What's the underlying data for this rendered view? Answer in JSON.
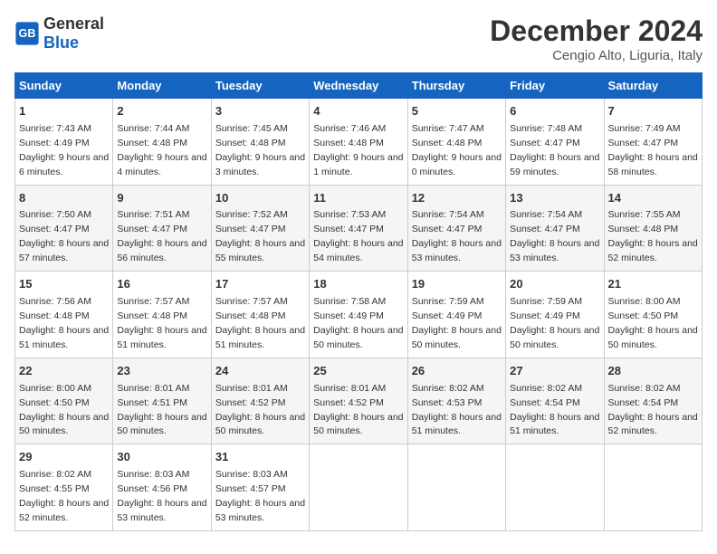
{
  "logo": {
    "general": "General",
    "blue": "Blue"
  },
  "title": "December 2024",
  "subtitle": "Cengio Alto, Liguria, Italy",
  "days_header": [
    "Sunday",
    "Monday",
    "Tuesday",
    "Wednesday",
    "Thursday",
    "Friday",
    "Saturday"
  ],
  "weeks": [
    [
      {
        "day": "1",
        "rise": "Sunrise: 7:43 AM",
        "set": "Sunset: 4:49 PM",
        "daylight": "Daylight: 9 hours and 6 minutes."
      },
      {
        "day": "2",
        "rise": "Sunrise: 7:44 AM",
        "set": "Sunset: 4:48 PM",
        "daylight": "Daylight: 9 hours and 4 minutes."
      },
      {
        "day": "3",
        "rise": "Sunrise: 7:45 AM",
        "set": "Sunset: 4:48 PM",
        "daylight": "Daylight: 9 hours and 3 minutes."
      },
      {
        "day": "4",
        "rise": "Sunrise: 7:46 AM",
        "set": "Sunset: 4:48 PM",
        "daylight": "Daylight: 9 hours and 1 minute."
      },
      {
        "day": "5",
        "rise": "Sunrise: 7:47 AM",
        "set": "Sunset: 4:48 PM",
        "daylight": "Daylight: 9 hours and 0 minutes."
      },
      {
        "day": "6",
        "rise": "Sunrise: 7:48 AM",
        "set": "Sunset: 4:47 PM",
        "daylight": "Daylight: 8 hours and 59 minutes."
      },
      {
        "day": "7",
        "rise": "Sunrise: 7:49 AM",
        "set": "Sunset: 4:47 PM",
        "daylight": "Daylight: 8 hours and 58 minutes."
      }
    ],
    [
      {
        "day": "8",
        "rise": "Sunrise: 7:50 AM",
        "set": "Sunset: 4:47 PM",
        "daylight": "Daylight: 8 hours and 57 minutes."
      },
      {
        "day": "9",
        "rise": "Sunrise: 7:51 AM",
        "set": "Sunset: 4:47 PM",
        "daylight": "Daylight: 8 hours and 56 minutes."
      },
      {
        "day": "10",
        "rise": "Sunrise: 7:52 AM",
        "set": "Sunset: 4:47 PM",
        "daylight": "Daylight: 8 hours and 55 minutes."
      },
      {
        "day": "11",
        "rise": "Sunrise: 7:53 AM",
        "set": "Sunset: 4:47 PM",
        "daylight": "Daylight: 8 hours and 54 minutes."
      },
      {
        "day": "12",
        "rise": "Sunrise: 7:54 AM",
        "set": "Sunset: 4:47 PM",
        "daylight": "Daylight: 8 hours and 53 minutes."
      },
      {
        "day": "13",
        "rise": "Sunrise: 7:54 AM",
        "set": "Sunset: 4:47 PM",
        "daylight": "Daylight: 8 hours and 53 minutes."
      },
      {
        "day": "14",
        "rise": "Sunrise: 7:55 AM",
        "set": "Sunset: 4:48 PM",
        "daylight": "Daylight: 8 hours and 52 minutes."
      }
    ],
    [
      {
        "day": "15",
        "rise": "Sunrise: 7:56 AM",
        "set": "Sunset: 4:48 PM",
        "daylight": "Daylight: 8 hours and 51 minutes."
      },
      {
        "day": "16",
        "rise": "Sunrise: 7:57 AM",
        "set": "Sunset: 4:48 PM",
        "daylight": "Daylight: 8 hours and 51 minutes."
      },
      {
        "day": "17",
        "rise": "Sunrise: 7:57 AM",
        "set": "Sunset: 4:48 PM",
        "daylight": "Daylight: 8 hours and 51 minutes."
      },
      {
        "day": "18",
        "rise": "Sunrise: 7:58 AM",
        "set": "Sunset: 4:49 PM",
        "daylight": "Daylight: 8 hours and 50 minutes."
      },
      {
        "day": "19",
        "rise": "Sunrise: 7:59 AM",
        "set": "Sunset: 4:49 PM",
        "daylight": "Daylight: 8 hours and 50 minutes."
      },
      {
        "day": "20",
        "rise": "Sunrise: 7:59 AM",
        "set": "Sunset: 4:49 PM",
        "daylight": "Daylight: 8 hours and 50 minutes."
      },
      {
        "day": "21",
        "rise": "Sunrise: 8:00 AM",
        "set": "Sunset: 4:50 PM",
        "daylight": "Daylight: 8 hours and 50 minutes."
      }
    ],
    [
      {
        "day": "22",
        "rise": "Sunrise: 8:00 AM",
        "set": "Sunset: 4:50 PM",
        "daylight": "Daylight: 8 hours and 50 minutes."
      },
      {
        "day": "23",
        "rise": "Sunrise: 8:01 AM",
        "set": "Sunset: 4:51 PM",
        "daylight": "Daylight: 8 hours and 50 minutes."
      },
      {
        "day": "24",
        "rise": "Sunrise: 8:01 AM",
        "set": "Sunset: 4:52 PM",
        "daylight": "Daylight: 8 hours and 50 minutes."
      },
      {
        "day": "25",
        "rise": "Sunrise: 8:01 AM",
        "set": "Sunset: 4:52 PM",
        "daylight": "Daylight: 8 hours and 50 minutes."
      },
      {
        "day": "26",
        "rise": "Sunrise: 8:02 AM",
        "set": "Sunset: 4:53 PM",
        "daylight": "Daylight: 8 hours and 51 minutes."
      },
      {
        "day": "27",
        "rise": "Sunrise: 8:02 AM",
        "set": "Sunset: 4:54 PM",
        "daylight": "Daylight: 8 hours and 51 minutes."
      },
      {
        "day": "28",
        "rise": "Sunrise: 8:02 AM",
        "set": "Sunset: 4:54 PM",
        "daylight": "Daylight: 8 hours and 52 minutes."
      }
    ],
    [
      {
        "day": "29",
        "rise": "Sunrise: 8:02 AM",
        "set": "Sunset: 4:55 PM",
        "daylight": "Daylight: 8 hours and 52 minutes."
      },
      {
        "day": "30",
        "rise": "Sunrise: 8:03 AM",
        "set": "Sunset: 4:56 PM",
        "daylight": "Daylight: 8 hours and 53 minutes."
      },
      {
        "day": "31",
        "rise": "Sunrise: 8:03 AM",
        "set": "Sunset: 4:57 PM",
        "daylight": "Daylight: 8 hours and 53 minutes."
      },
      null,
      null,
      null,
      null
    ]
  ]
}
